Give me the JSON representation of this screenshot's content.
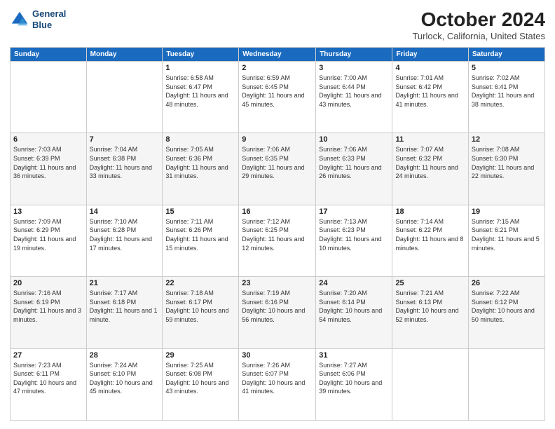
{
  "header": {
    "logo_line1": "General",
    "logo_line2": "Blue",
    "month": "October 2024",
    "location": "Turlock, California, United States"
  },
  "weekdays": [
    "Sunday",
    "Monday",
    "Tuesday",
    "Wednesday",
    "Thursday",
    "Friday",
    "Saturday"
  ],
  "weeks": [
    [
      {
        "day": "",
        "info": ""
      },
      {
        "day": "",
        "info": ""
      },
      {
        "day": "1",
        "info": "Sunrise: 6:58 AM\nSunset: 6:47 PM\nDaylight: 11 hours and 48 minutes."
      },
      {
        "day": "2",
        "info": "Sunrise: 6:59 AM\nSunset: 6:45 PM\nDaylight: 11 hours and 45 minutes."
      },
      {
        "day": "3",
        "info": "Sunrise: 7:00 AM\nSunset: 6:44 PM\nDaylight: 11 hours and 43 minutes."
      },
      {
        "day": "4",
        "info": "Sunrise: 7:01 AM\nSunset: 6:42 PM\nDaylight: 11 hours and 41 minutes."
      },
      {
        "day": "5",
        "info": "Sunrise: 7:02 AM\nSunset: 6:41 PM\nDaylight: 11 hours and 38 minutes."
      }
    ],
    [
      {
        "day": "6",
        "info": "Sunrise: 7:03 AM\nSunset: 6:39 PM\nDaylight: 11 hours and 36 minutes."
      },
      {
        "day": "7",
        "info": "Sunrise: 7:04 AM\nSunset: 6:38 PM\nDaylight: 11 hours and 33 minutes."
      },
      {
        "day": "8",
        "info": "Sunrise: 7:05 AM\nSunset: 6:36 PM\nDaylight: 11 hours and 31 minutes."
      },
      {
        "day": "9",
        "info": "Sunrise: 7:06 AM\nSunset: 6:35 PM\nDaylight: 11 hours and 29 minutes."
      },
      {
        "day": "10",
        "info": "Sunrise: 7:06 AM\nSunset: 6:33 PM\nDaylight: 11 hours and 26 minutes."
      },
      {
        "day": "11",
        "info": "Sunrise: 7:07 AM\nSunset: 6:32 PM\nDaylight: 11 hours and 24 minutes."
      },
      {
        "day": "12",
        "info": "Sunrise: 7:08 AM\nSunset: 6:30 PM\nDaylight: 11 hours and 22 minutes."
      }
    ],
    [
      {
        "day": "13",
        "info": "Sunrise: 7:09 AM\nSunset: 6:29 PM\nDaylight: 11 hours and 19 minutes."
      },
      {
        "day": "14",
        "info": "Sunrise: 7:10 AM\nSunset: 6:28 PM\nDaylight: 11 hours and 17 minutes."
      },
      {
        "day": "15",
        "info": "Sunrise: 7:11 AM\nSunset: 6:26 PM\nDaylight: 11 hours and 15 minutes."
      },
      {
        "day": "16",
        "info": "Sunrise: 7:12 AM\nSunset: 6:25 PM\nDaylight: 11 hours and 12 minutes."
      },
      {
        "day": "17",
        "info": "Sunrise: 7:13 AM\nSunset: 6:23 PM\nDaylight: 11 hours and 10 minutes."
      },
      {
        "day": "18",
        "info": "Sunrise: 7:14 AM\nSunset: 6:22 PM\nDaylight: 11 hours and 8 minutes."
      },
      {
        "day": "19",
        "info": "Sunrise: 7:15 AM\nSunset: 6:21 PM\nDaylight: 11 hours and 5 minutes."
      }
    ],
    [
      {
        "day": "20",
        "info": "Sunrise: 7:16 AM\nSunset: 6:19 PM\nDaylight: 11 hours and 3 minutes."
      },
      {
        "day": "21",
        "info": "Sunrise: 7:17 AM\nSunset: 6:18 PM\nDaylight: 11 hours and 1 minute."
      },
      {
        "day": "22",
        "info": "Sunrise: 7:18 AM\nSunset: 6:17 PM\nDaylight: 10 hours and 59 minutes."
      },
      {
        "day": "23",
        "info": "Sunrise: 7:19 AM\nSunset: 6:16 PM\nDaylight: 10 hours and 56 minutes."
      },
      {
        "day": "24",
        "info": "Sunrise: 7:20 AM\nSunset: 6:14 PM\nDaylight: 10 hours and 54 minutes."
      },
      {
        "day": "25",
        "info": "Sunrise: 7:21 AM\nSunset: 6:13 PM\nDaylight: 10 hours and 52 minutes."
      },
      {
        "day": "26",
        "info": "Sunrise: 7:22 AM\nSunset: 6:12 PM\nDaylight: 10 hours and 50 minutes."
      }
    ],
    [
      {
        "day": "27",
        "info": "Sunrise: 7:23 AM\nSunset: 6:11 PM\nDaylight: 10 hours and 47 minutes."
      },
      {
        "day": "28",
        "info": "Sunrise: 7:24 AM\nSunset: 6:10 PM\nDaylight: 10 hours and 45 minutes."
      },
      {
        "day": "29",
        "info": "Sunrise: 7:25 AM\nSunset: 6:08 PM\nDaylight: 10 hours and 43 minutes."
      },
      {
        "day": "30",
        "info": "Sunrise: 7:26 AM\nSunset: 6:07 PM\nDaylight: 10 hours and 41 minutes."
      },
      {
        "day": "31",
        "info": "Sunrise: 7:27 AM\nSunset: 6:06 PM\nDaylight: 10 hours and 39 minutes."
      },
      {
        "day": "",
        "info": ""
      },
      {
        "day": "",
        "info": ""
      }
    ]
  ]
}
